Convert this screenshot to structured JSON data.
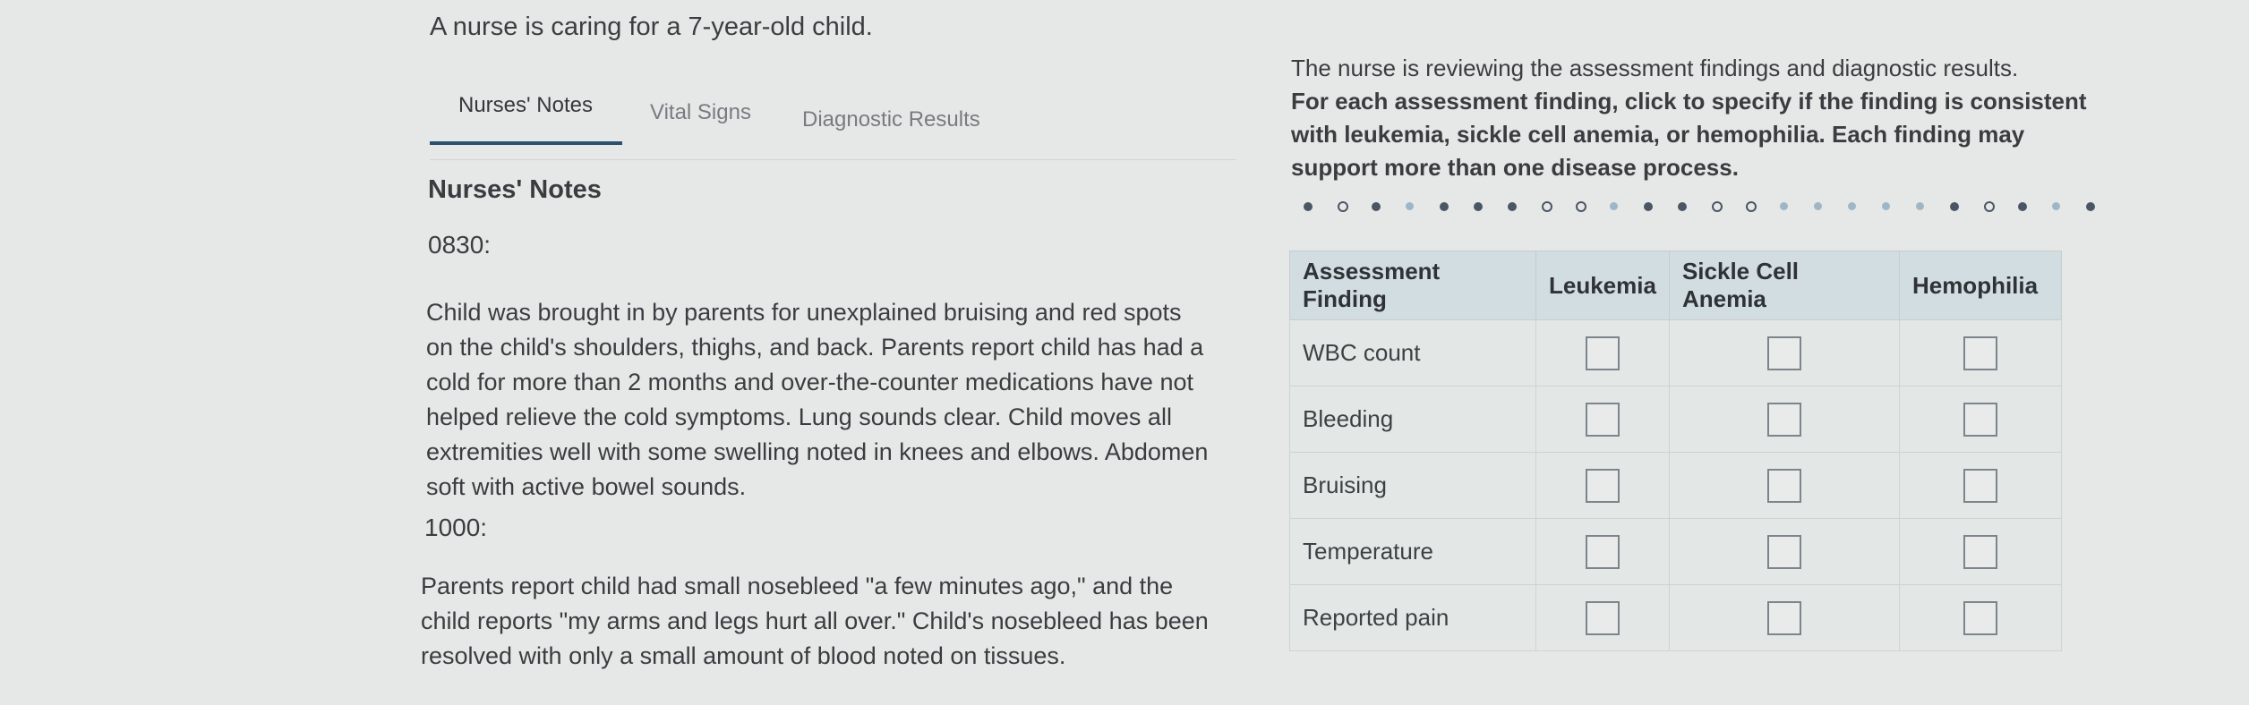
{
  "scenario": "A nurse is caring for a 7-year-old child.",
  "tabs": [
    {
      "label": "Nurses' Notes"
    },
    {
      "label": "Vital Signs"
    },
    {
      "label": "Diagnostic Results"
    }
  ],
  "notes": {
    "heading": "Nurses' Notes",
    "entries": [
      {
        "time": "0830:",
        "lines": [
          "Child was brought in by parents for unexplained bruising and red spots",
          "on the child's shoulders, thighs, and back. Parents report child has had a",
          "cold for more than 2 months and over-the-counter medications have not",
          "helped relieve the cold symptoms. Lung sounds clear. Child moves all",
          "extremities well with some swelling noted in knees and elbows. Abdomen",
          "soft with active bowel sounds."
        ]
      },
      {
        "time": "1000:",
        "lines": [
          "Parents report child had small nosebleed \"a few minutes ago,\" and the",
          "child reports \"my arms and legs hurt all over.\" Child's nosebleed has been",
          "resolved with only a small amount of blood noted on tissues."
        ]
      }
    ]
  },
  "instructions": {
    "intro": "The nurse is reviewing the assessment findings and diagnostic results.",
    "bold_lines": [
      "For each assessment finding, click to specify if the finding is consistent",
      "with leukemia, sickle cell anemia, or hemophilia. Each finding may",
      "support more than one disease process."
    ]
  },
  "table": {
    "headers": [
      "Assessment Finding",
      "Leukemia",
      "Sickle Cell Anemia",
      "Hemophilia"
    ],
    "rows": [
      {
        "finding": "WBC count",
        "leukemia": false,
        "sickle": false,
        "hemophilia": false
      },
      {
        "finding": "Bleeding",
        "leukemia": false,
        "sickle": false,
        "hemophilia": false
      },
      {
        "finding": "Bruising",
        "leukemia": false,
        "sickle": false,
        "hemophilia": false
      },
      {
        "finding": "Temperature",
        "leukemia": false,
        "sickle": false,
        "hemophilia": false
      },
      {
        "finding": "Reported pain",
        "leukemia": false,
        "sickle": false,
        "hemophilia": false
      }
    ]
  }
}
